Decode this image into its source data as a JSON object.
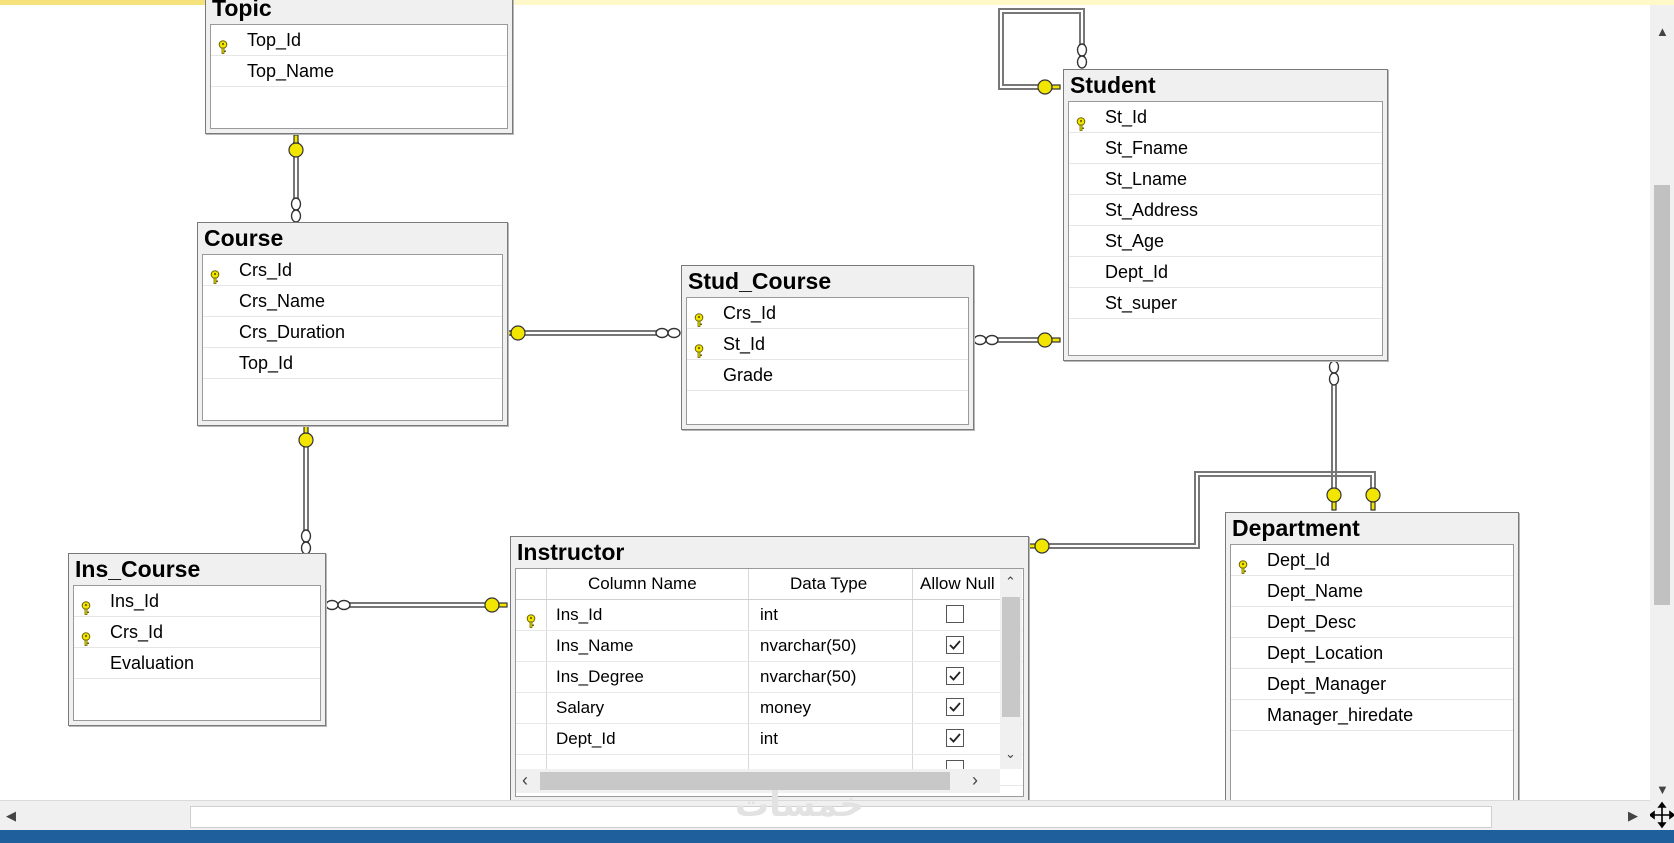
{
  "tables": {
    "topic": {
      "title": "Topic",
      "columns": [
        {
          "name": "Top_Id",
          "key": true
        },
        {
          "name": "Top_Name",
          "key": false
        }
      ]
    },
    "course": {
      "title": "Course",
      "columns": [
        {
          "name": "Crs_Id",
          "key": true
        },
        {
          "name": "Crs_Name",
          "key": false
        },
        {
          "name": "Crs_Duration",
          "key": false
        },
        {
          "name": "Top_Id",
          "key": false
        }
      ]
    },
    "stud_course": {
      "title": "Stud_Course",
      "columns": [
        {
          "name": "Crs_Id",
          "key": true
        },
        {
          "name": "St_Id",
          "key": true
        },
        {
          "name": "Grade",
          "key": false
        }
      ]
    },
    "student": {
      "title": "Student",
      "columns": [
        {
          "name": "St_Id",
          "key": true
        },
        {
          "name": "St_Fname",
          "key": false
        },
        {
          "name": "St_Lname",
          "key": false
        },
        {
          "name": "St_Address",
          "key": false
        },
        {
          "name": "St_Age",
          "key": false
        },
        {
          "name": "Dept_Id",
          "key": false
        },
        {
          "name": "St_super",
          "key": false
        }
      ]
    },
    "ins_course": {
      "title": "Ins_Course",
      "columns": [
        {
          "name": "Ins_Id",
          "key": true
        },
        {
          "name": "Crs_Id",
          "key": true
        },
        {
          "name": "Evaluation",
          "key": false
        }
      ]
    },
    "department": {
      "title": "Department",
      "columns": [
        {
          "name": "Dept_Id",
          "key": true
        },
        {
          "name": "Dept_Name",
          "key": false
        },
        {
          "name": "Dept_Desc",
          "key": false
        },
        {
          "name": "Dept_Location",
          "key": false
        },
        {
          "name": "Dept_Manager",
          "key": false
        },
        {
          "name": "Manager_hiredate",
          "key": false
        }
      ]
    },
    "instructor": {
      "title": "Instructor",
      "headers": {
        "name": "Column Name",
        "type": "Data Type",
        "null": "Allow Null"
      },
      "rows": [
        {
          "name": "Ins_Id",
          "type": "int",
          "allow_null": false,
          "key": true
        },
        {
          "name": "Ins_Name",
          "type": "nvarchar(50)",
          "allow_null": true,
          "key": false
        },
        {
          "name": "Ins_Degree",
          "type": "nvarchar(50)",
          "allow_null": true,
          "key": false
        },
        {
          "name": "Salary",
          "type": "money",
          "allow_null": true,
          "key": false
        },
        {
          "name": "Dept_Id",
          "type": "int",
          "allow_null": true,
          "key": false
        }
      ]
    }
  },
  "watermark": "خمسات",
  "colors": {
    "key": "#f2e600",
    "selection_strip": "#f5e27a",
    "taskbar": "#1f5f9c",
    "canvas": "#ffffff"
  },
  "icons": {
    "primary_key": "key-icon",
    "relationship_one": "key-end-icon",
    "relationship_many": "infinity-end-icon"
  }
}
